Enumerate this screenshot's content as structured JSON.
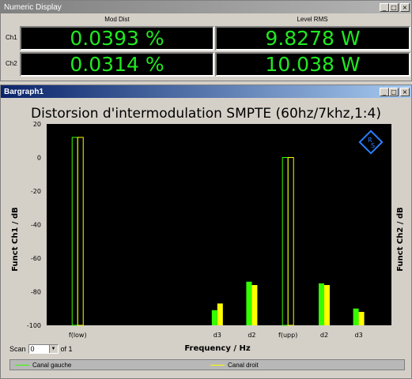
{
  "numeric_window": {
    "title": "Numeric Display",
    "columns": [
      "Mod Dist",
      "Level RMS"
    ],
    "rows": [
      {
        "label": "Ch1",
        "mod_dist": "0.0393 %",
        "level_rms": "9.8278 W"
      },
      {
        "label": "Ch2",
        "mod_dist": "0.0314 %",
        "level_rms": "10.038 W"
      }
    ]
  },
  "bargraph_window": {
    "title": "Bargraph1",
    "scan_label": "Scan",
    "scan_value": "0",
    "scan_of": "of 1"
  },
  "window_buttons": {
    "minimize": "_",
    "restore": "□",
    "close": "×"
  },
  "colors": {
    "ch1": "#33ff00",
    "ch2": "#ffff00",
    "value_text": "#21e821"
  },
  "chart_data": {
    "type": "bar",
    "title": "Distorsion d'intermodulation SMPTE (60hz/7khz,1:4)",
    "xlabel": "Frequency / Hz",
    "ylabel": "Funct Ch1 / dB",
    "ylabel_right": "Funct Ch2 / dB",
    "ylim": [
      -100,
      20
    ],
    "yticks": [
      20,
      0,
      -20,
      -40,
      -60,
      -80,
      -100
    ],
    "categories": [
      "f(low)",
      "d3",
      "d2",
      "f(upp)",
      "d2",
      "d3"
    ],
    "series": [
      {
        "name": "Canal gauche",
        "values": [
          12,
          -91,
          -74,
          0,
          -75,
          -90
        ]
      },
      {
        "name": "Canal droit",
        "values": [
          12,
          -87,
          -76,
          0,
          -76,
          -92
        ]
      }
    ],
    "outlined_categories": [
      "f(low)",
      "f(upp)"
    ]
  }
}
